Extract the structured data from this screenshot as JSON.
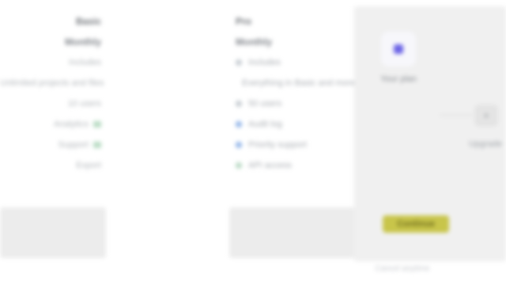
{
  "left_column": {
    "heading": "Basic",
    "subheading": "Monthly",
    "rows": [
      "Includes",
      "Unlimited projects and files",
      "10 users",
      "Analytics",
      "Support",
      "Export"
    ]
  },
  "middle_column": {
    "heading": "Pro",
    "subheading": "Monthly",
    "rows": [
      "Includes",
      "Everything in Basic and more",
      "50 users",
      "Audit log",
      "Priority support",
      "API access"
    ]
  },
  "side_panel": {
    "card_label": "Your plan",
    "badge_symbol": "+",
    "badge_label": "Upgrade",
    "action_label": "Continue",
    "footer_note": "Cancel anytime"
  },
  "colors": {
    "accent_button": "#c8c54a",
    "app_icon": "#6b63e6"
  },
  "icons": [
    "app-icon",
    "plus-icon",
    "check-icon",
    "dot-icon"
  ]
}
